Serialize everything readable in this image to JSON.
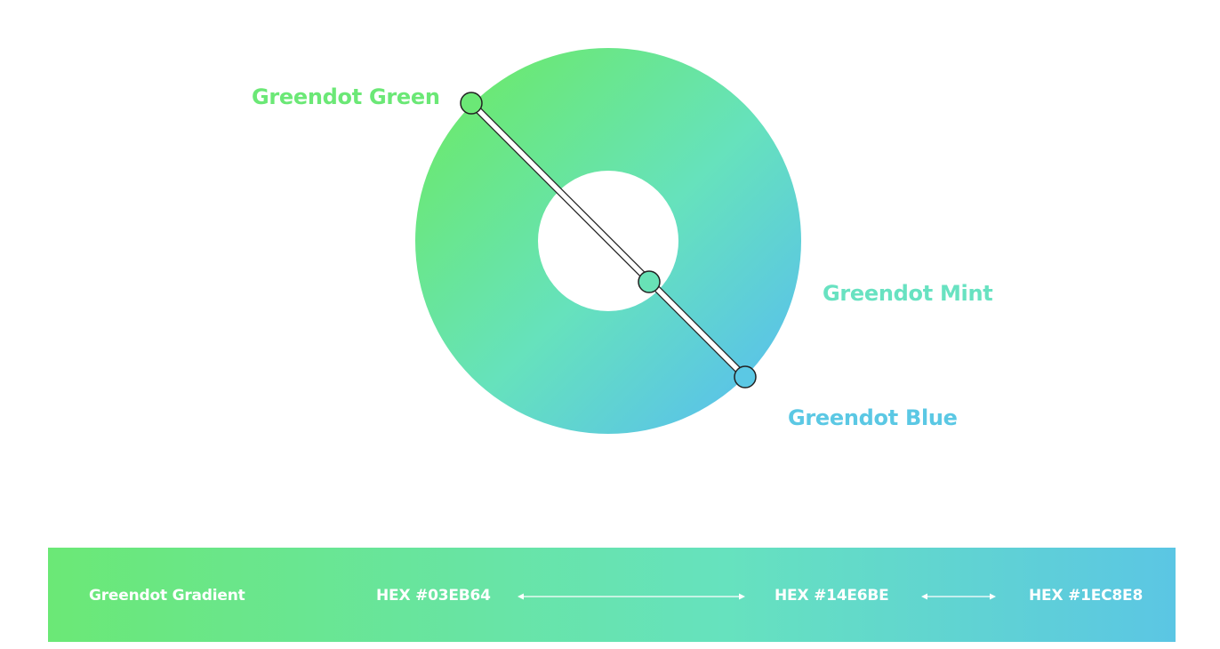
{
  "diagram": {
    "labels": {
      "green": "Greendot Green",
      "mint": "Greendot Mint",
      "blue": "Greendot Blue"
    }
  },
  "gradient_bar": {
    "title": "Greendot Gradient",
    "hex_green": "HEX #03EB64",
    "hex_mint": "HEX #14E6BE",
    "hex_blue": "HEX #1EC8E8"
  },
  "colors": {
    "green": "#6BE876",
    "mint": "#68E2C1",
    "blue": "#5BC8E4",
    "white": "#ffffff"
  },
  "icons": [
    "double-arrow-icon",
    "double-arrow-icon"
  ]
}
